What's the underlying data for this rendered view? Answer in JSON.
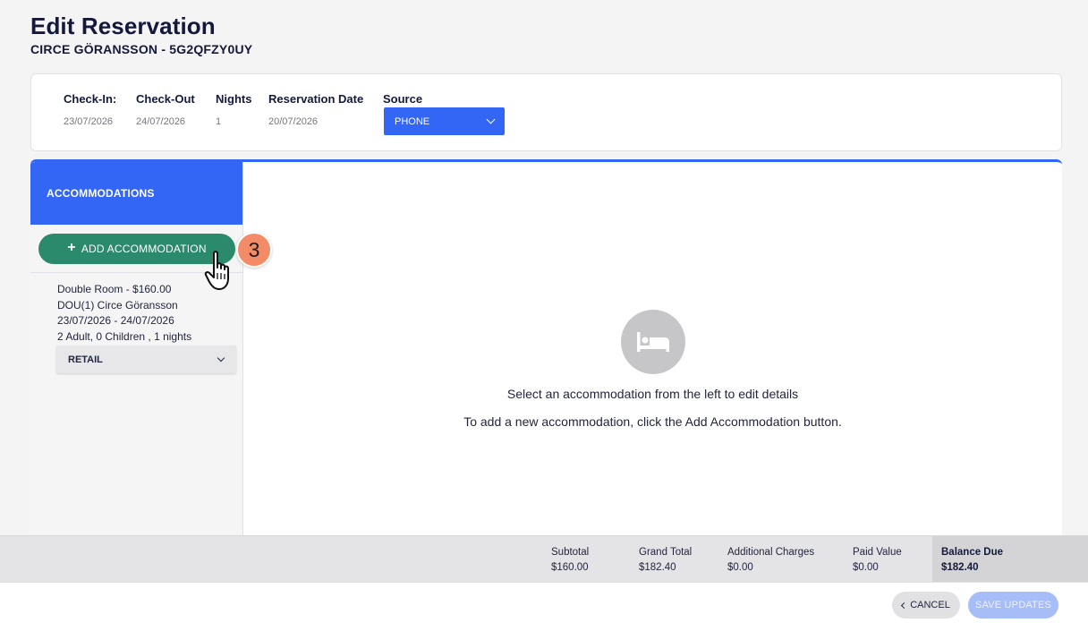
{
  "header": {
    "title": "Edit Reservation",
    "subtitle": "CIRCE GÖRANSSON - 5G2QFZY0UY"
  },
  "info": {
    "check_in_label": "Check-In:",
    "check_in_value": "23/07/2026",
    "check_out_label": "Check-Out",
    "check_out_value": "24/07/2026",
    "nights_label": "Nights",
    "nights_value": "1",
    "reservation_date_label": "Reservation Date",
    "reservation_date_value": "20/07/2026",
    "source_label": "Source",
    "source_value": "PHONE"
  },
  "sidebar": {
    "header": "ACCOMMODATIONS",
    "add_button": "ADD ACCOMMODATION",
    "accommodation": {
      "line1": "Double Room - $160.00",
      "line2": "DOU(1) Circe Göransson",
      "line3": "23/07/2026 - 24/07/2026",
      "line4": "2 Adult, 0 Children , 1 nights",
      "rate": "RETAIL"
    }
  },
  "step_badge": "3",
  "empty_state": {
    "icon": "bed-icon",
    "line1": "Select an accommodation from the left to edit details",
    "line2": "To add a new accommodation, click the Add Accommodation button."
  },
  "totals": {
    "subtotal_label": "Subtotal",
    "subtotal_value": "$160.00",
    "grand_total_label": "Grand Total",
    "grand_total_value": "$182.40",
    "additional_label": "Additional Charges",
    "additional_value": "$0.00",
    "paid_label": "Paid Value",
    "paid_value": "$0.00",
    "balance_label": "Balance Due",
    "balance_value": "$182.40"
  },
  "footer": {
    "cancel": "CANCEL",
    "save": "SAVE UPDATES"
  },
  "colors": {
    "primary": "#3366f5",
    "success": "#2c8a6c",
    "badge": "#f38b66"
  }
}
